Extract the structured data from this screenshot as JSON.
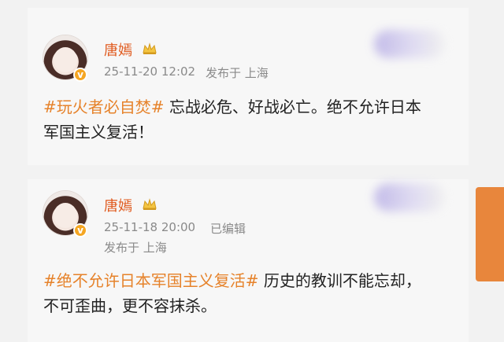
{
  "posts": [
    {
      "author": "唐嫣",
      "timestamp": "25-11-20 12:02",
      "location": "发布于 上海",
      "hashtag": "#玩火者必自焚#",
      "text_line1": " 忘战必危、好战必亡。绝不允许日本",
      "text_line2": "军国主义复活！"
    },
    {
      "author": "唐嫣",
      "timestamp": "25-11-18 20:00",
      "edited": "已编辑",
      "location": "发布于 上海",
      "hashtag": "#绝不允许日本军国主义复活#",
      "text_line1": " 历史的教训不能忘却，",
      "text_line2": "不可歪曲，更不容抹杀。"
    }
  ],
  "badge_letter": "v",
  "colors": {
    "name": "#e05a1e",
    "hashtag": "#e6822a",
    "meta": "#8a8a8a",
    "badge": "#f5a623"
  },
  "icons": [
    "crown-icon",
    "verified-badge-icon"
  ]
}
